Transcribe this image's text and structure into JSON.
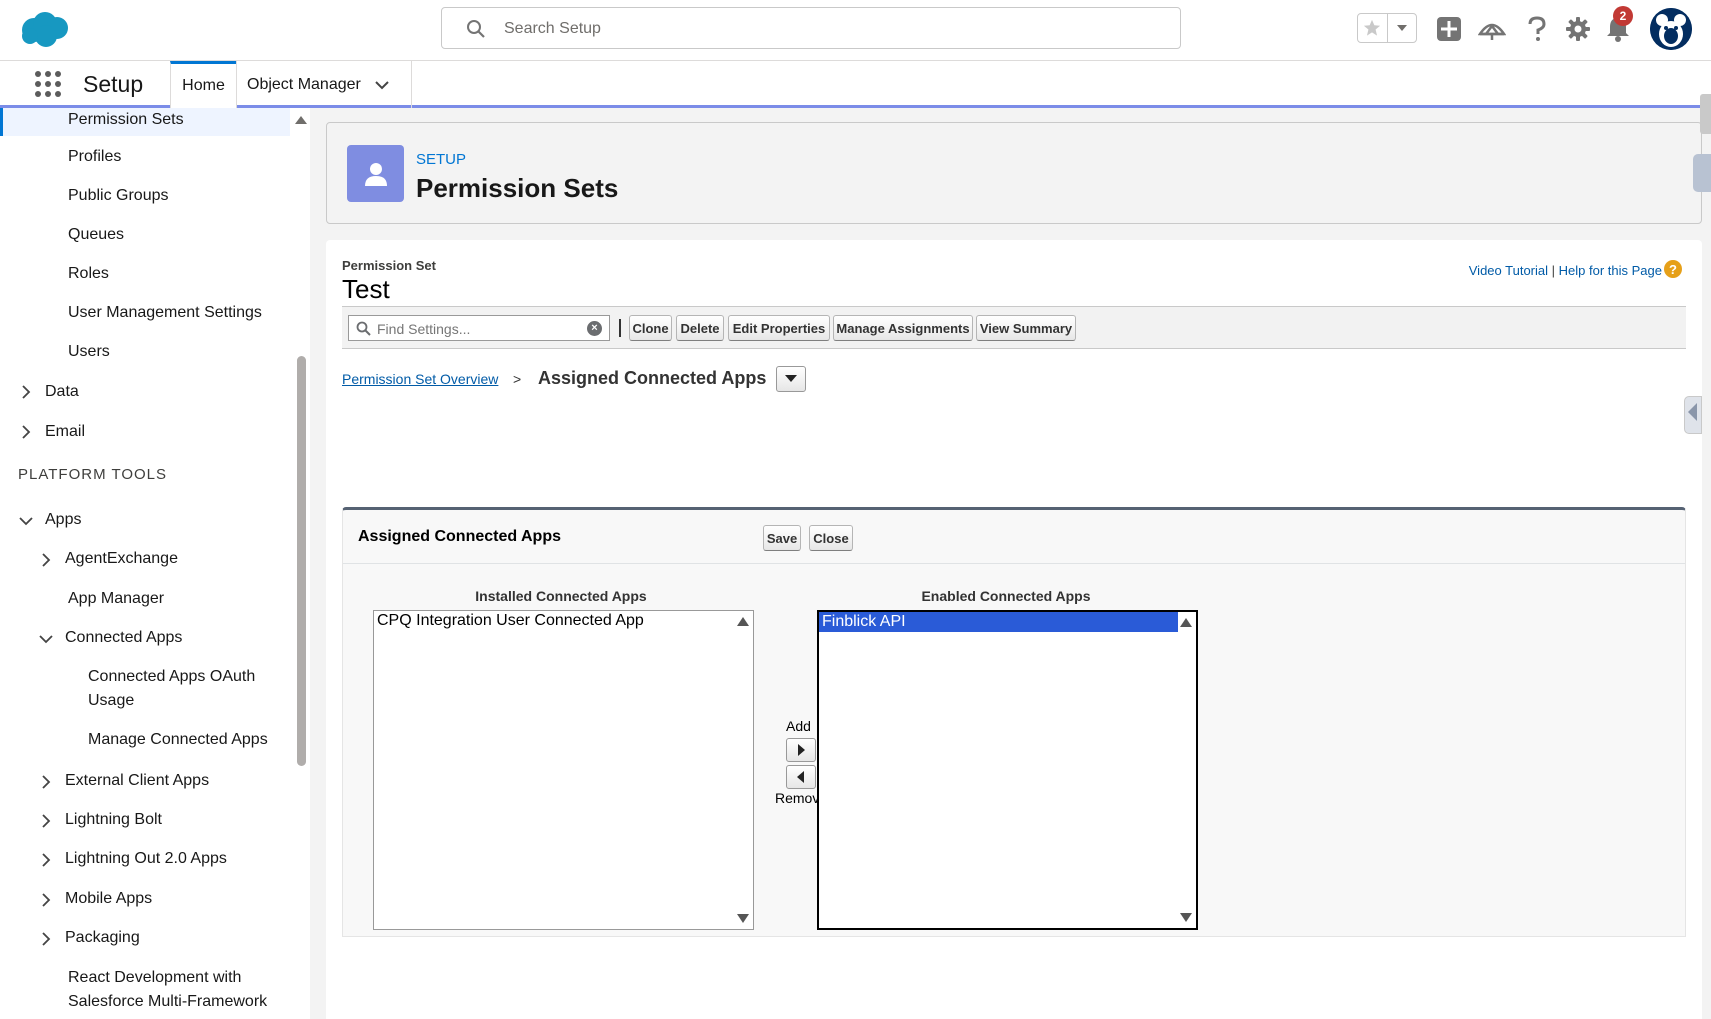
{
  "header": {
    "search_placeholder": "Search Setup",
    "notification_count": "2",
    "icons": [
      "salesforce-cloud-icon",
      "search-icon",
      "star-icon",
      "chevron-down-icon",
      "plus-icon",
      "trailhead-icon",
      "help-icon",
      "gear-icon",
      "bell-icon",
      "avatar"
    ]
  },
  "app_nav": {
    "app_name": "Setup",
    "tabs": [
      {
        "label": "Home",
        "active": true
      },
      {
        "label": "Object Manager",
        "active": false
      }
    ]
  },
  "sidebar": {
    "items": [
      {
        "label": "Permission Sets",
        "selected": true
      },
      {
        "label": "Profiles"
      },
      {
        "label": "Public Groups"
      },
      {
        "label": "Queues"
      },
      {
        "label": "Roles"
      },
      {
        "label": "User Management Settings"
      },
      {
        "label": "Users"
      },
      {
        "label": "Data"
      },
      {
        "label": "Email"
      },
      {
        "label": "Apps"
      },
      {
        "label": "AgentExchange"
      },
      {
        "label": "App Manager"
      },
      {
        "label": "Connected Apps"
      },
      {
        "label": "Connected Apps OAuth Usage"
      },
      {
        "label": "Manage Connected Apps"
      },
      {
        "label": "External Client Apps"
      },
      {
        "label": "Lightning Bolt"
      },
      {
        "label": "Lightning Out 2.0 Apps"
      },
      {
        "label": "Mobile Apps"
      },
      {
        "label": "Packaging"
      },
      {
        "label": "React Development with Salesforce Multi-Framework"
      }
    ],
    "section_platform_tools": "PLATFORM TOOLS"
  },
  "page_header": {
    "eyebrow": "SETUP",
    "title": "Permission Sets"
  },
  "permission_set": {
    "label": "Permission Set",
    "name": "Test",
    "help_video": "Video Tutorial",
    "help_sep": "|",
    "help_page": "Help for this Page",
    "help_q": "?"
  },
  "toolbar": {
    "find_placeholder": "Find Settings...",
    "buttons": {
      "clone": "Clone",
      "delete": "Delete",
      "edit_properties": "Edit Properties",
      "manage_assignments": "Manage Assignments",
      "view_summary": "View Summary"
    }
  },
  "breadcrumb": {
    "overview": "Permission Set Overview",
    "sep": ">",
    "current": "Assigned Connected Apps"
  },
  "assigned_apps": {
    "title": "Assigned Connected Apps",
    "save": "Save",
    "close": "Close",
    "installed_label": "Installed Connected Apps",
    "installed_options": [
      "CPQ Integration User Connected App"
    ],
    "enabled_label": "Enabled Connected Apps",
    "enabled_options": [
      {
        "label": "Finblick API",
        "selected": true
      }
    ],
    "add_label": "Add",
    "remove_label": "Remove"
  },
  "colors": {
    "brand_blue": "#0176d3",
    "setup_icon_bg": "#7f8de1",
    "link_blue": "#015ba7",
    "selected_option": "#2a5bd7",
    "badge_red": "#c23934",
    "help_orange": "#e6a019"
  }
}
